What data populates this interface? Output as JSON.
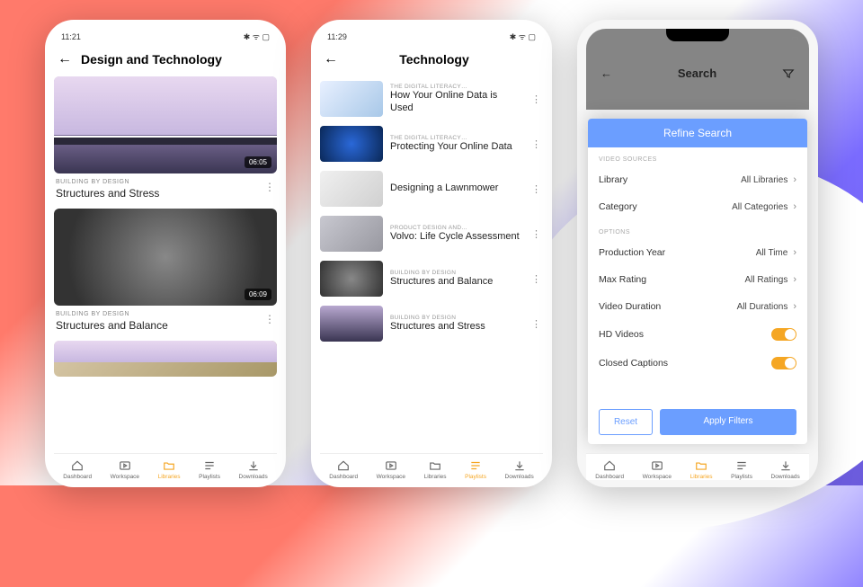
{
  "accent": "#f5a623",
  "blue": "#6b9eff",
  "phone1": {
    "time": "11:21",
    "title": "Design and Technology",
    "cards": [
      {
        "category": "BUILDING BY DESIGN",
        "title": "Structures and Stress",
        "duration": "06:05"
      },
      {
        "category": "BUILDING BY DESIGN",
        "title": "Structures and Balance",
        "duration": "06:09"
      }
    ],
    "active_tab": "Libraries"
  },
  "phone2": {
    "time": "11:29",
    "title": "Technology",
    "rows": [
      {
        "category": "THE DIGITAL LITERACY…",
        "title": "How Your Online Data is Used"
      },
      {
        "category": "THE DIGITAL LITERACY…",
        "title": "Protecting Your Online Data"
      },
      {
        "category": "",
        "title": "Designing a Lawnmower"
      },
      {
        "category": "PRODUCT DESIGN AND…",
        "title": "Volvo: Life Cycle Assessment"
      },
      {
        "category": "BUILDING BY DESIGN",
        "title": "Structures and Balance"
      },
      {
        "category": "BUILDING BY DESIGN",
        "title": "Structures and Stress"
      }
    ],
    "active_tab": "Playlists"
  },
  "phone3": {
    "search_title": "Search",
    "panel_title": "Refine Search",
    "sections": {
      "sources_label": "VIDEO SOURCES",
      "options_label": "OPTIONS"
    },
    "opts": {
      "library": {
        "label": "Library",
        "value": "All Libraries"
      },
      "category": {
        "label": "Category",
        "value": "All Categories"
      },
      "year": {
        "label": "Production Year",
        "value": "All Time"
      },
      "rating": {
        "label": "Max Rating",
        "value": "All Ratings"
      },
      "duration": {
        "label": "Video Duration",
        "value": "All Durations"
      },
      "hd": {
        "label": "HD Videos",
        "on": true
      },
      "cc": {
        "label": "Closed Captions",
        "on": true
      }
    },
    "reset": "Reset",
    "apply": "Apply Filters",
    "active_tab": "Libraries"
  },
  "tabs": [
    {
      "id": "dashboard",
      "label": "Dashboard"
    },
    {
      "id": "workspace",
      "label": "Workspace"
    },
    {
      "id": "libraries",
      "label": "Libraries"
    },
    {
      "id": "playlists",
      "label": "Playlists"
    },
    {
      "id": "downloads",
      "label": "Downloads"
    }
  ]
}
